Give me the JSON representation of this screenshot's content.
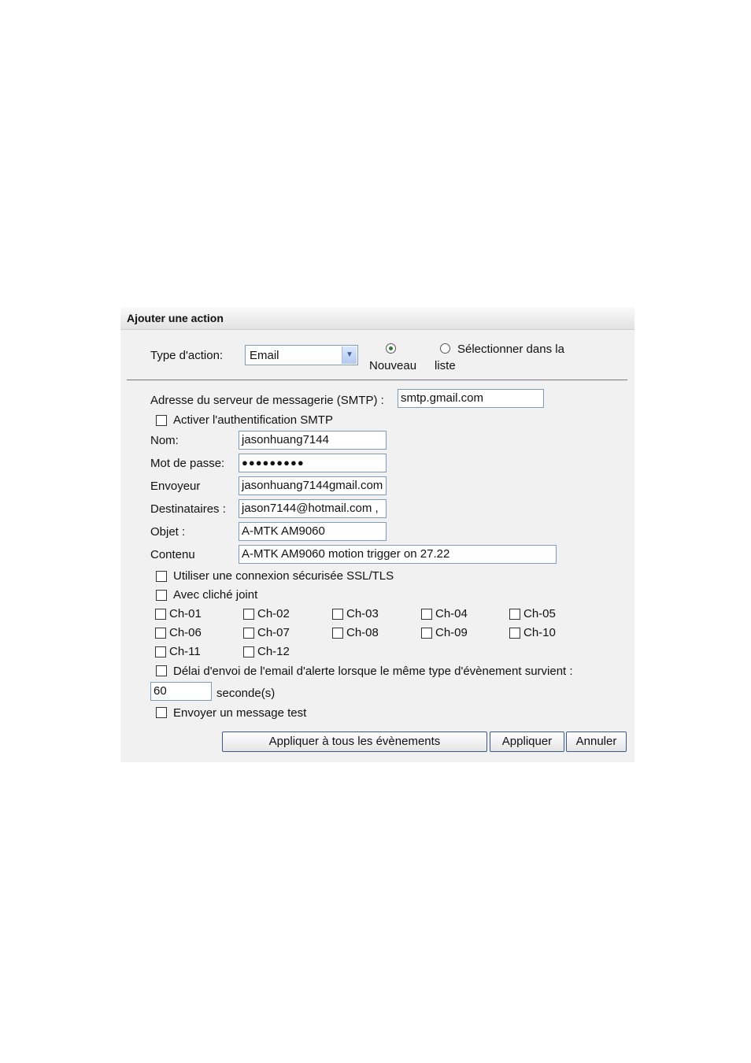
{
  "dialog": {
    "title": "Ajouter une action"
  },
  "type_action": {
    "label": "Type d'action:",
    "selected": "Email",
    "radio_new": "Nouveau",
    "radio_list_line1": "Sélectionner dans la",
    "radio_list_line2": "liste"
  },
  "smtp": {
    "server_label": "Adresse du serveur de messagerie (SMTP) :",
    "server_value": "smtp.gmail.com",
    "auth_label": "Activer l'authentification SMTP"
  },
  "fields": {
    "nom_label": "Nom:",
    "nom_value": "jasonhuang7144",
    "password_label": "Mot de passe:",
    "password_value": "●●●●●●●●●",
    "sender_label": "Envoyeur",
    "sender_value": "jasonhuang7144gmail.com",
    "recipients_label": "Destinataires :",
    "recipients_value": "jason7144@hotmail.com ,",
    "subject_label": "Objet :",
    "subject_value": "A-MTK AM9060",
    "content_label": "Contenu",
    "content_value": "A-MTK AM9060 motion trigger on 27.22"
  },
  "options": {
    "ssl_label": "Utiliser une connexion sécurisée SSL/TLS",
    "snapshot_label": "Avec cliché joint"
  },
  "channels": [
    "Ch-01",
    "Ch-02",
    "Ch-03",
    "Ch-04",
    "Ch-05",
    "Ch-06",
    "Ch-07",
    "Ch-08",
    "Ch-09",
    "Ch-10",
    "Ch-11",
    "Ch-12"
  ],
  "delay": {
    "label": "Délai d'envoi de l'email d'alerte lorsque le même type d'évènement survient :",
    "value": "60",
    "unit": "seconde(s)"
  },
  "test_label": "Envoyer un message test",
  "buttons": {
    "apply_all": "Appliquer à tous les évènements",
    "apply": "Appliquer",
    "cancel": "Annuler"
  }
}
